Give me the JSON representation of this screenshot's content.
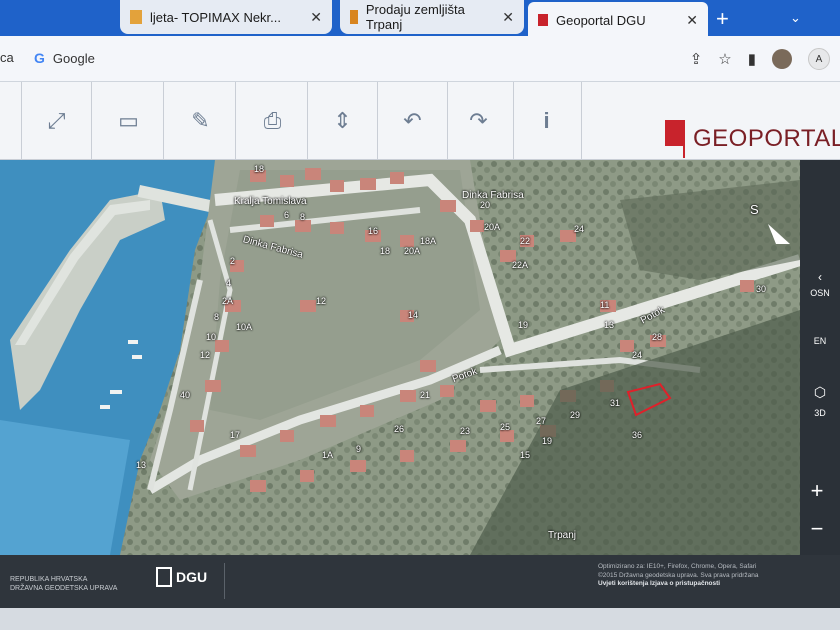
{
  "browser": {
    "tabs": [
      {
        "label": "ljeta- TOPIMAX Nekr...",
        "active": false
      },
      {
        "label": "Prodaju zemljišta Trpanj",
        "active": false
      },
      {
        "label": "Geoportal DGU",
        "active": true
      }
    ],
    "new_tab": "+",
    "tab_menu": "⌄",
    "bookmarks": [
      {
        "label": "ca"
      },
      {
        "label": "Google"
      }
    ],
    "profile_initials": "A"
  },
  "toolbar": {
    "tools": [
      {
        "name": "fullscreen",
        "glyph": "⤢"
      },
      {
        "name": "draw-rectangle",
        "glyph": "▭"
      },
      {
        "name": "edit",
        "glyph": "✎"
      },
      {
        "name": "print",
        "glyph": "⎙"
      },
      {
        "name": "compare",
        "glyph": "⇕"
      },
      {
        "name": "undo",
        "glyph": "↶"
      },
      {
        "name": "redo",
        "glyph": "↷"
      },
      {
        "name": "info",
        "glyph": "i"
      }
    ],
    "logo_text": "GEOPORTAL"
  },
  "map": {
    "streets": [
      "Kralja Tomislava",
      "Dinka Fabrisa",
      "Dinka Fabrisa",
      "Potok",
      "Potok",
      "Trpanj"
    ],
    "house_numbers": [
      "18",
      "6",
      "8",
      "16",
      "18A",
      "20",
      "20A",
      "22",
      "24",
      "22A",
      "19",
      "11",
      "13",
      "30",
      "2",
      "4",
      "2A",
      "8",
      "10",
      "10A",
      "12",
      "14",
      "12",
      "24",
      "28",
      "21",
      "23",
      "25",
      "27",
      "29",
      "31",
      "26",
      "36",
      "13",
      "17",
      "1A",
      "9",
      "15",
      "19",
      "20A",
      "18",
      "40"
    ],
    "compass": "S"
  },
  "right_panel": {
    "items": [
      "OSN",
      "EN",
      "3D"
    ],
    "zoom_in": "+",
    "zoom_out": "−"
  },
  "footer": {
    "org_line1": "REPUBLIKA HRVATSKA",
    "org_line2": "DRŽAVNA GEODETSKA UPRAVA",
    "dgu_label": "DGU",
    "copyright_line1": "Optimizirano za: IE10+, Firefox, Chrome, Opera, Safari",
    "copyright_line2": "©2015 Državna geodetska uprava. Sva prava pridržana",
    "copyright_line3": "Uvjeti korištenja Izjava o pristupačnosti"
  }
}
